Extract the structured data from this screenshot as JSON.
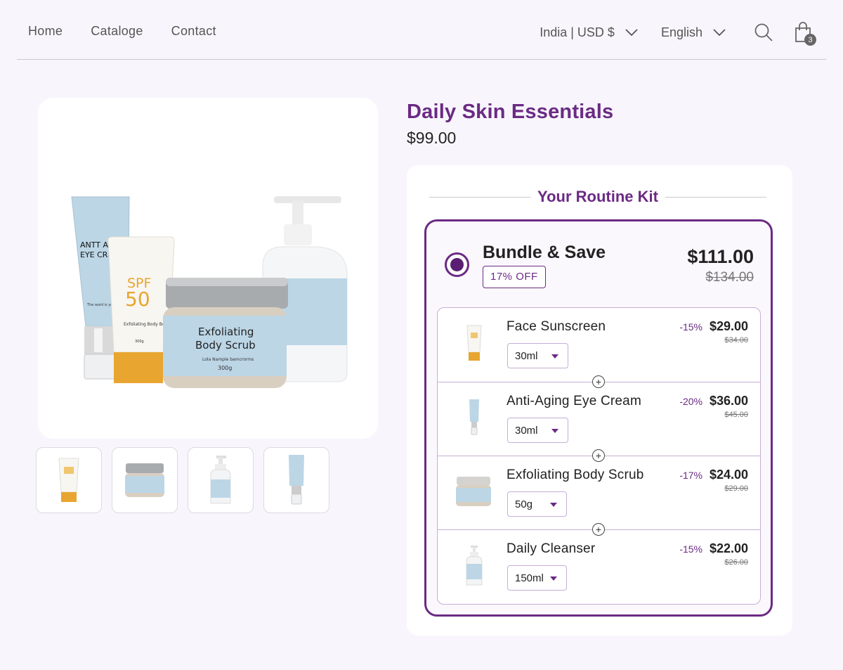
{
  "nav": {
    "home": "Home",
    "catalog": "Cataloge",
    "contact": "Contact"
  },
  "header": {
    "country": "India | USD $",
    "language": "English",
    "cart_count": "3"
  },
  "product": {
    "main_image": {
      "tube_text_1": "ANTT AG",
      "tube_text_2": "EYE CRE",
      "tube_small": "The word is yours for your skin.",
      "spf_1": "SPF",
      "spf_2": "50",
      "spf_small": "Exfoliating Body Body Scrub",
      "spf_weight": "300g",
      "jar_1": "Exfoliating",
      "jar_2": "Body Scrub",
      "jar_small": "Lola Nample bamcrorms",
      "jar_weight": "300g"
    },
    "title": "Daily Skin Essentials",
    "price": "$99.00"
  },
  "kit": {
    "heading": "Your Routine Kit",
    "bundle": {
      "name": "Bundle & Save",
      "off": "17% OFF",
      "price": "$111.00",
      "original": "$134.00"
    },
    "items": [
      {
        "name": "Face Sunscreen",
        "size": "30ml",
        "discount": "-15%",
        "price": "$29.00",
        "original": "$34.00"
      },
      {
        "name": "Anti-Aging Eye Cream",
        "size": "30ml",
        "discount": "-20%",
        "price": "$36.00",
        "original": "$45.00"
      },
      {
        "name": "Exfoliating Body Scrub",
        "size": "50g",
        "discount": "-17%",
        "price": "$24.00",
        "original": "$29.00"
      },
      {
        "name": "Daily Cleanser",
        "size": "150ml",
        "discount": "-15%",
        "price": "$22.00",
        "original": "$26.00"
      }
    ]
  },
  "colors": {
    "brand": "#6b2a84",
    "label_blue": "#bcd6e6",
    "cap_orange": "#e8a530"
  }
}
